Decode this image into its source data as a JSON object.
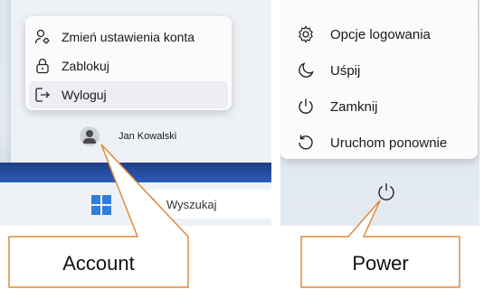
{
  "account_menu": {
    "items": [
      {
        "label": "Zmień ustawienia konta",
        "icon": "account-settings-icon"
      },
      {
        "label": "Zablokuj",
        "icon": "lock-icon"
      },
      {
        "label": "Wyloguj",
        "icon": "sign-out-icon",
        "highlighted": true
      }
    ]
  },
  "user": {
    "name": "Jan Kowalski"
  },
  "taskbar": {
    "search_label": "Wyszukaj"
  },
  "power_menu": {
    "items": [
      {
        "label": "Opcje logowania",
        "icon": "gear-icon"
      },
      {
        "label": "Uśpij",
        "icon": "moon-icon"
      },
      {
        "label": "Zamknij",
        "icon": "power-icon"
      },
      {
        "label": "Uruchom ponownie",
        "icon": "restart-icon"
      }
    ]
  },
  "callouts": {
    "account": "Account",
    "power": "Power"
  },
  "colors": {
    "callout_border": "#e08a3a",
    "taskbar_accent": "#1e3f86"
  }
}
